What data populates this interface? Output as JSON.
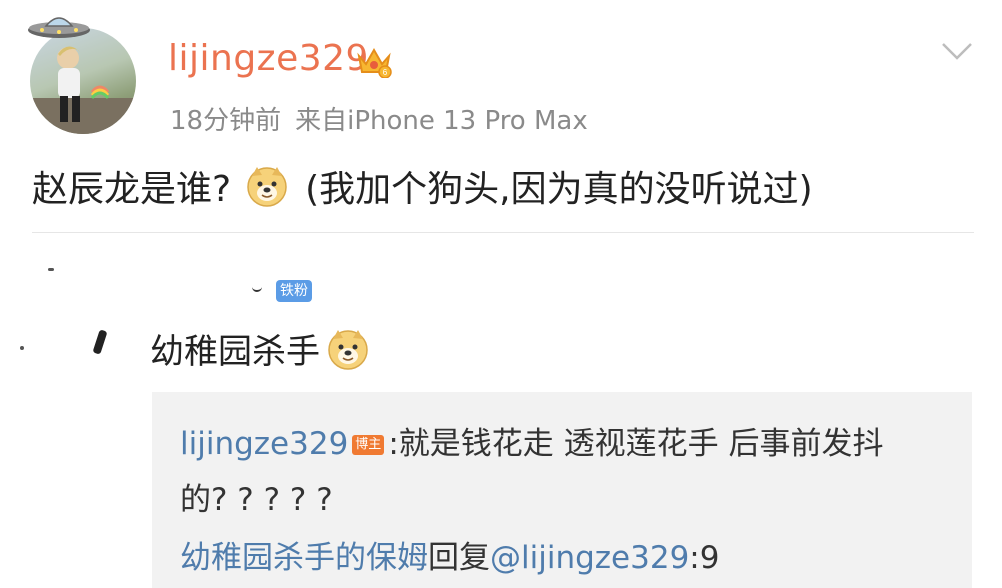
{
  "post": {
    "username": "lijingze329",
    "time": "18分钟前",
    "source": "来自iPhone 13 Pro Max",
    "text_before": "赵辰龙是谁?",
    "text_after": "(我加个狗头,因为真的没听说过)"
  },
  "comment": {
    "fan_badge": "铁粉",
    "text": "幼稚园杀手"
  },
  "replies": [
    {
      "author": "lijingze329",
      "author_badge": "博主",
      "separator": ":",
      "text": "就是钱花走 透视莲花手 后事前发抖 的? ? ? ? ?"
    },
    {
      "author": "幼稚园杀手的保姆",
      "action": "回复",
      "mention": "@lijingze329",
      "text": ":9"
    }
  ],
  "icons": [
    "ufo-icon",
    "crown-vip-icon",
    "chevron-down-icon",
    "doge-emoji-icon"
  ],
  "colors": {
    "username": "#eb7350",
    "link": "#4f7cac",
    "meta": "#8a8a8a",
    "host_badge": "#f07a32",
    "fan_badge": "#5b9ce6",
    "reply_bg": "#f2f2f2"
  }
}
